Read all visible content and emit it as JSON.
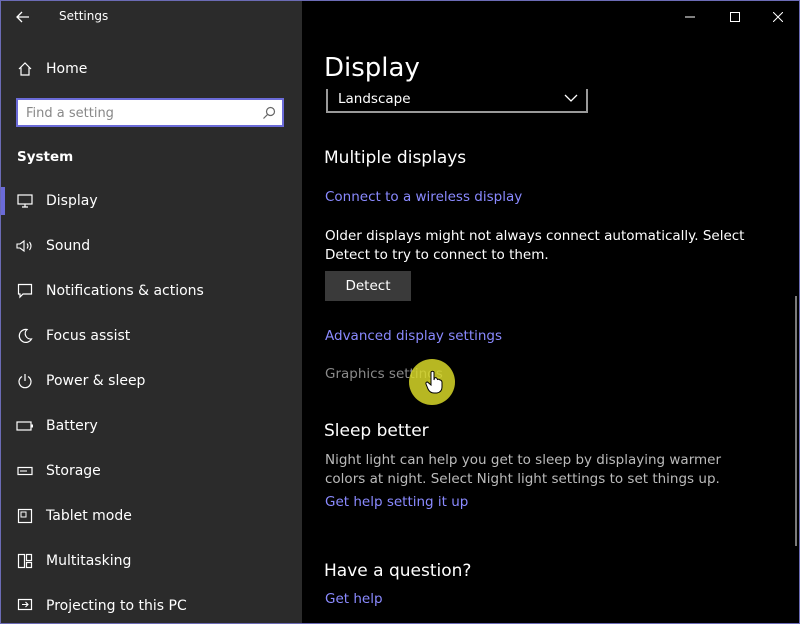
{
  "window": {
    "title": "Settings",
    "controls": {
      "minimize_icon": "minimize-icon",
      "maximize_icon": "maximize-icon",
      "close_icon": "close-icon"
    }
  },
  "sidebar": {
    "home_label": "Home",
    "search": {
      "placeholder": "Find a setting",
      "value": ""
    },
    "section_label": "System",
    "items": [
      {
        "label": "Display",
        "icon": "monitor-icon",
        "selected": true
      },
      {
        "label": "Sound",
        "icon": "speaker-icon"
      },
      {
        "label": "Notifications & actions",
        "icon": "notification-icon"
      },
      {
        "label": "Focus assist",
        "icon": "moon-icon"
      },
      {
        "label": "Power & sleep",
        "icon": "power-icon"
      },
      {
        "label": "Battery",
        "icon": "battery-icon"
      },
      {
        "label": "Storage",
        "icon": "storage-icon"
      },
      {
        "label": "Tablet mode",
        "icon": "tablet-icon"
      },
      {
        "label": "Multitasking",
        "icon": "multitasking-icon"
      },
      {
        "label": "Projecting to this PC",
        "icon": "projecting-icon"
      }
    ]
  },
  "main": {
    "title": "Display",
    "orientation_select": {
      "value": "Landscape"
    },
    "multiple_displays": {
      "heading": "Multiple displays",
      "connect_link": "Connect to a wireless display",
      "description": "Older displays might not always connect automatically. Select Detect to try to connect to them.",
      "detect_button": "Detect",
      "advanced_link": "Advanced display settings",
      "graphics_link": "Graphics settings"
    },
    "sleep_better": {
      "heading": "Sleep better",
      "description": "Night light can help you get to sleep by displaying warmer colors at night. Select Night light settings to set things up.",
      "help_link": "Get help setting it up"
    },
    "question": {
      "heading": "Have a question?",
      "help_link": "Get help"
    }
  },
  "colors": {
    "accent": "#6b6bd8",
    "link": "#8a8aff",
    "sidebar_bg": "#2b2b2b",
    "main_bg": "#000000",
    "cursor_highlight": "#d7d728"
  }
}
